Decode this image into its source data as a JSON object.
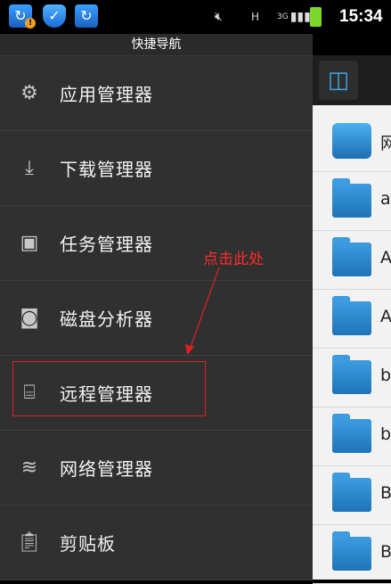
{
  "status_bar": {
    "time": "15:34",
    "network": "3G",
    "h_indicator": "H",
    "badge": "!"
  },
  "drawer": {
    "title": "快捷导航",
    "items": [
      {
        "label": "应用管理器",
        "icon": "gears-icon"
      },
      {
        "label": "下载管理器",
        "icon": "download-icon"
      },
      {
        "label": "任务管理器",
        "icon": "task-icon"
      },
      {
        "label": "磁盘分析器",
        "icon": "disk-icon"
      },
      {
        "label": "远程管理器",
        "icon": "ftp-icon"
      },
      {
        "label": "网络管理器",
        "icon": "wifi-icon"
      },
      {
        "label": "剪贴板",
        "icon": "clipboard-icon"
      }
    ]
  },
  "annotation": {
    "text": "点击此处",
    "color": "#e02020"
  },
  "file_list": {
    "items": [
      {
        "letter": "网",
        "icon": "cloud-drive-icon"
      },
      {
        "letter": "a",
        "icon": "folder-icon"
      },
      {
        "letter": "A",
        "icon": "folder-icon"
      },
      {
        "letter": "A",
        "icon": "folder-icon"
      },
      {
        "letter": "b",
        "icon": "folder-icon"
      },
      {
        "letter": "b",
        "icon": "folder-icon"
      },
      {
        "letter": "B",
        "icon": "folder-icon"
      },
      {
        "letter": "B",
        "icon": "folder-icon"
      }
    ]
  }
}
